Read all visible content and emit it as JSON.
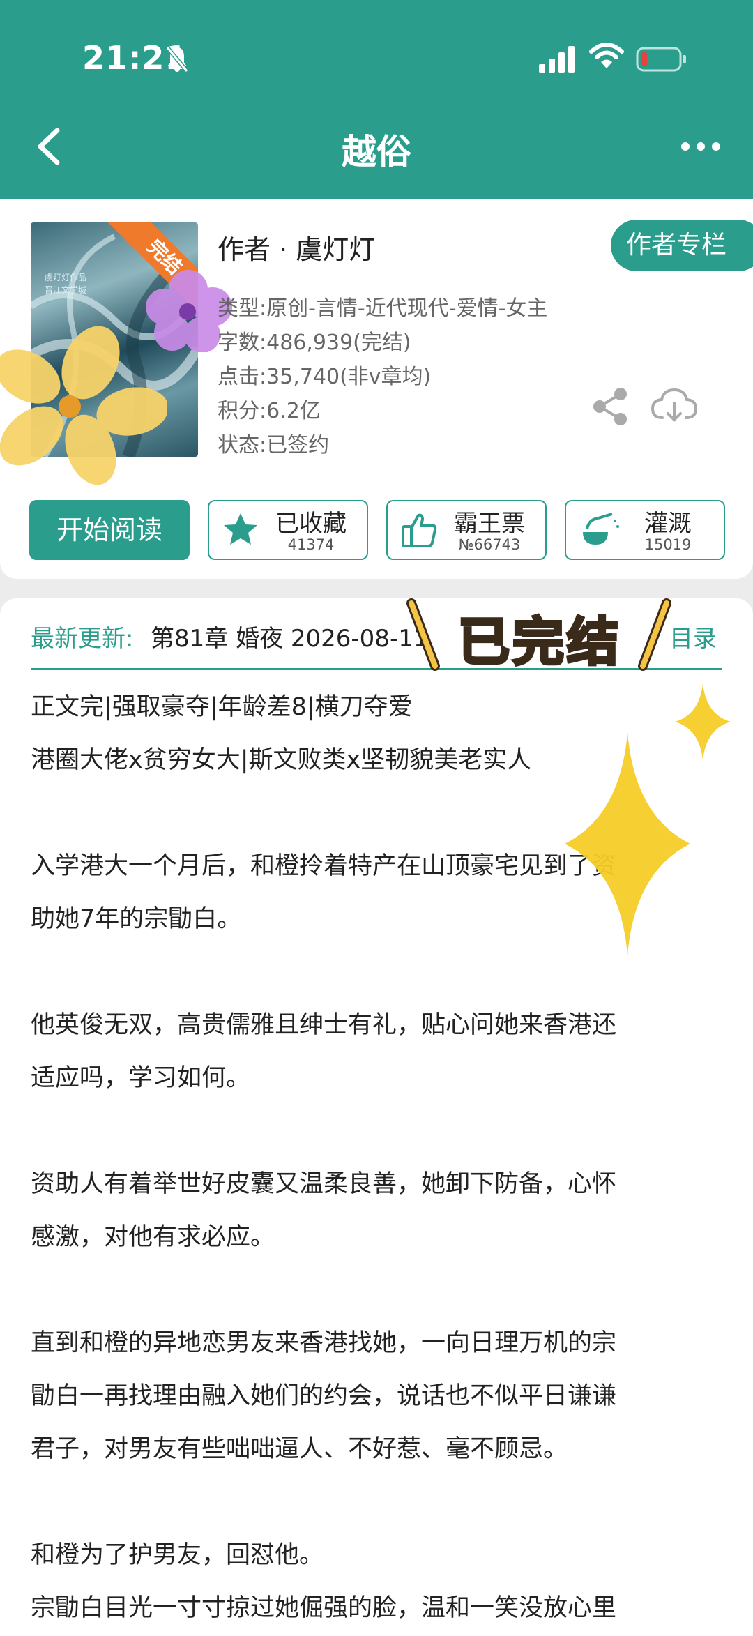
{
  "status_bar": {
    "time": "21:21"
  },
  "nav": {
    "title": "越俗"
  },
  "book": {
    "cover_badge": "完结",
    "cover_text_1": "虞灯灯作品",
    "cover_text_2": "晋江文学城",
    "author": "作者 · 虞灯灯",
    "author_column_button": "作者专栏",
    "type": "类型:原创-言情-近代现代-爱情-女主",
    "word_count": "字数:486,939(完结)",
    "clicks": "点击:35,740(非v章均)",
    "points": "积分:6.2亿",
    "status": "状态:已签约"
  },
  "actions": {
    "read_label": "开始阅读",
    "collect": {
      "label": "已收藏",
      "count": "41374"
    },
    "ticket": {
      "label": "霸王票",
      "count": "№66743"
    },
    "water": {
      "label": "灌溉",
      "count": "15019"
    }
  },
  "latest": {
    "label": "最新更新:",
    "chapter": "第81章 婚夜 2026-08-11 ",
    "toc_label": "目录"
  },
  "sticker": {
    "text": "已完结"
  },
  "synopsis": [
    "正文完|强取豪夺|年龄差8|横刀夺爱",
    "港圈大佬x贫穷女大|斯文败类x坚韧貌美老实人",
    "入学港大一个月后，和橙拎着特产在山顶豪宅见到了资",
    "助她7年的宗勖白。",
    "他英俊无双，高贵儒雅且绅士有礼，贴心问她来香港还",
    "适应吗，学习如何。",
    "资助人有着举世好皮囊又温柔良善，她卸下防备，心怀",
    "感激，对他有求必应。",
    "直到和橙的异地恋男友来香港找她，一向日理万机的宗",
    "勖白一再找理由融入她们的约会，说话也不似平日谦谦",
    "君子，对男友有些咄咄逼人、不好惹、毫不顾忌。",
    "和橙为了护男友，回怼他。",
    "宗勖白目光一寸寸掠过她倔强的脸，温和一笑没放心里"
  ],
  "colors": {
    "brand": "#2a9d8c",
    "ribbon": "#f07a2c",
    "sticker": "#f6c445"
  }
}
